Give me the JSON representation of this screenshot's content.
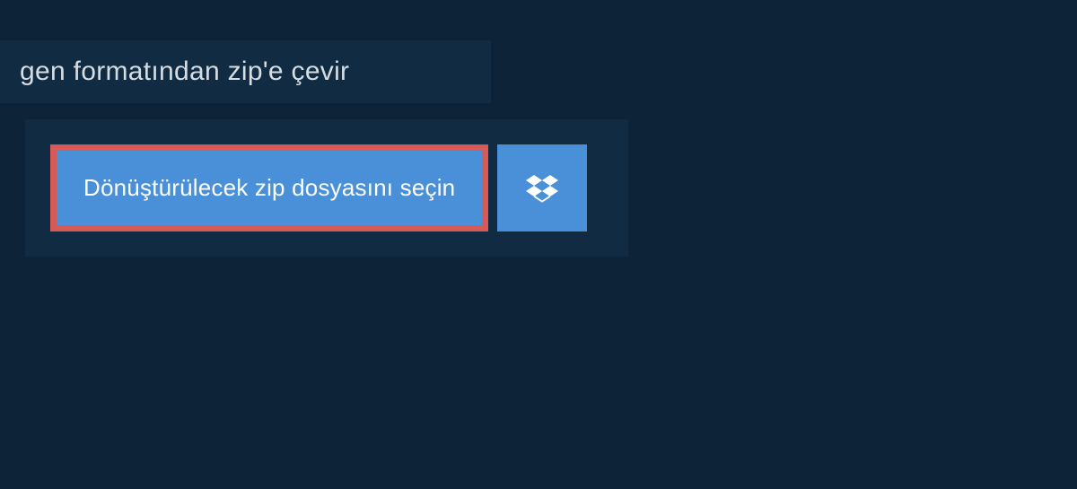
{
  "header": {
    "title": "gen formatından zip'e çevir"
  },
  "main": {
    "select_file_label": "Dönüştürülecek zip dosyasını seçin",
    "dropbox_icon_name": "dropbox-icon"
  },
  "colors": {
    "background": "#0d2438",
    "panel": "#112b42",
    "button": "#4a90d9",
    "highlight_border": "#d85a56",
    "text_primary": "#d5dde4",
    "text_button": "#ffffff"
  }
}
